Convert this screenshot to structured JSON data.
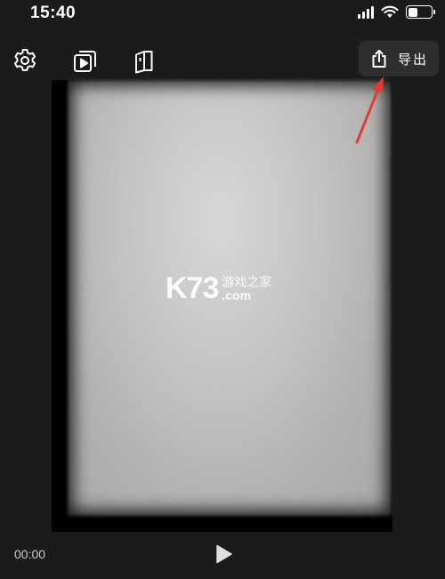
{
  "status_bar": {
    "time": "15:40",
    "icons": [
      "signal-icon",
      "wifi-icon",
      "battery-icon"
    ]
  },
  "toolbar": {
    "icons": [
      "settings-gear-icon",
      "play-layers-icon",
      "book-icon"
    ],
    "export_label": "导出",
    "export_icon": "share-upload-icon"
  },
  "preview": {
    "watermark_logo": "K73",
    "watermark_cn": "游戏之家",
    "watermark_domain": ".com"
  },
  "player": {
    "current_time": "00:00",
    "play_icon": "play-icon"
  },
  "colors": {
    "background": "#1b1b1b",
    "export_button": "#2e2e2e",
    "annotation_arrow": "#e53935"
  }
}
